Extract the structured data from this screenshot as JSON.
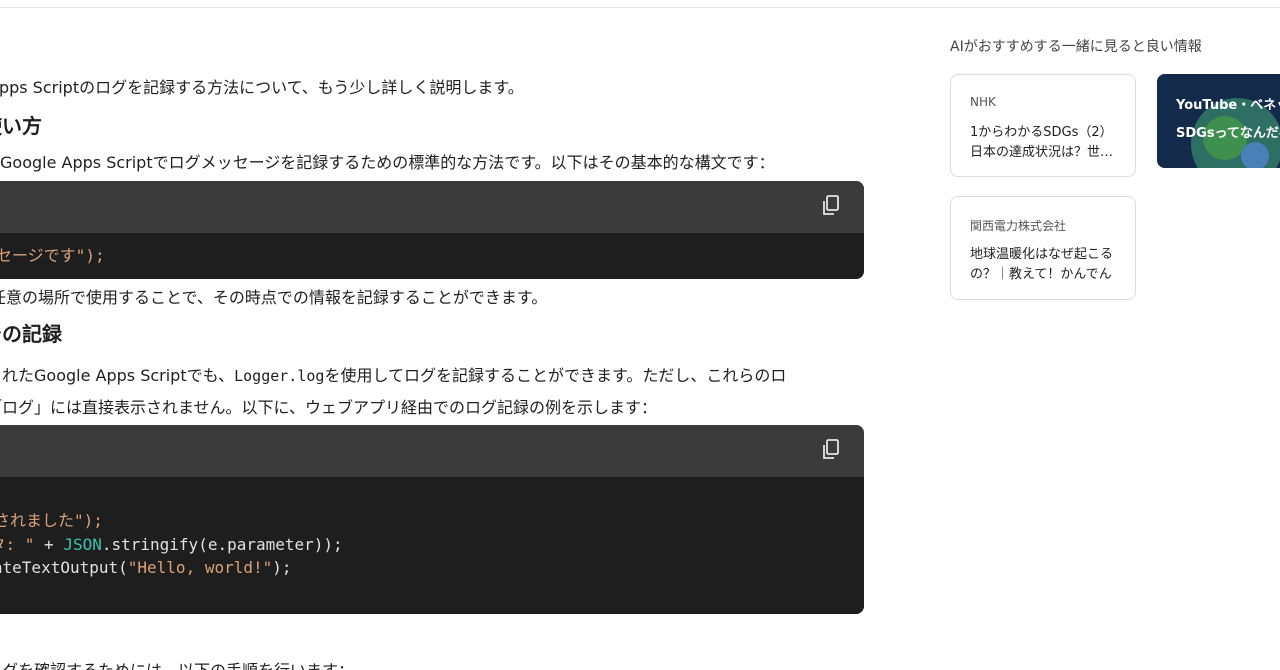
{
  "main": {
    "intro": "Apps Scriptのログを記録する方法について、もう少し詳しく説明します。",
    "heading1": "使い方",
    "desc1": "はGoogle Apps Scriptでログメッセージを記録するための標準的な方法です。以下はその基本的な構文です：",
    "code1": {
      "line1_str": "ログメッセージです\");"
    },
    "after_code1": "任意の場所で使用することで、その時点での情報を記録することができます。",
    "heading2": "での記録",
    "desc2a_pre": "されたGoogle Apps Scriptでも、",
    "desc2a_code": "Logger.log",
    "desc2a_post": "を使用してログを記録することができます。ただし、これらのロ",
    "desc2b": "「ログ」には直接表示されません。以下に、ウェブアプリ経由でのログ記録の例を示します：",
    "code2": {
      "line1_str": "び出されました\");",
      "line2_str": "パラメータ: \"",
      "line2_plus": " + ",
      "line2_ident": "JSON",
      "line2_rest": ".stringify(e.parameter));",
      "line3_plain": "createTextOutput(",
      "line3_str": "\"Hello, world!\"",
      "line3_end": ");"
    },
    "bottom": "ログを確認するためには、以下の手順を行います："
  },
  "sidebar": {
    "title": "AIがおすすめする一緒に見ると良い情報",
    "cards": [
      {
        "source": "NHK",
        "title": "1からわかるSDGs（2）日本の達成状況は？世…"
      },
      {
        "source": "関西電力株式会社",
        "title": "地球温暖化はなぜ起こるの？｜教えて！かんでん"
      }
    ],
    "video_card": {
      "line1": "YouTube・ベネッセ",
      "line2": "SDGsってなんだろう"
    }
  },
  "icons": [
    "copy-icon"
  ]
}
